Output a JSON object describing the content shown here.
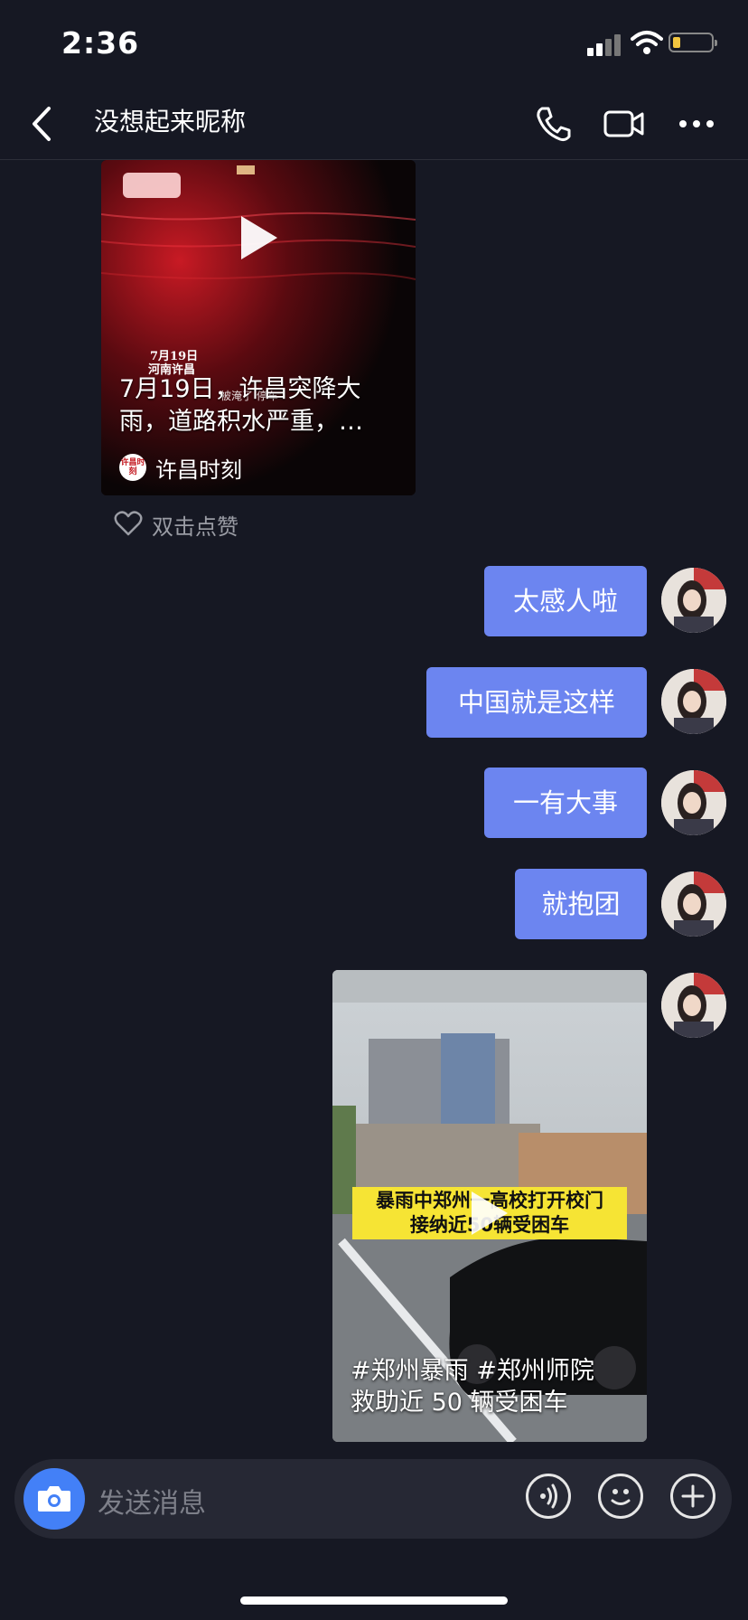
{
  "status_bar": {
    "time": "2:36"
  },
  "header": {
    "title": "没想起来昵称"
  },
  "messages": {
    "video1": {
      "overlay_date": "7月19日",
      "overlay_place": "河南许昌",
      "overlay_small": "被淹了 停车",
      "caption": "7月19日，许昌突降大雨，道路积水严重，…",
      "source_logo": "许昌时刻",
      "source": "许昌时刻",
      "like_hint": "双击点赞"
    },
    "bubbles": [
      "太感人啦",
      "中国就是这样",
      "一有大事",
      "就抱团"
    ],
    "video2": {
      "banner_line1": "暴雨中郑州一高校打开校门",
      "banner_line2": "接纳近50辆受困车",
      "caption": "#郑州暴雨 #郑州师院 救助近 50 辆受困车"
    }
  },
  "input": {
    "placeholder": "发送消息"
  },
  "colors": {
    "background": "#161823",
    "bubble": "#6c85f0",
    "camera_button": "#4380f7",
    "battery": "#f3c640"
  },
  "icons": [
    "back-icon",
    "phone-icon",
    "video-call-icon",
    "more-icon",
    "play-icon",
    "heart-icon",
    "camera-icon",
    "voice-icon",
    "emoji-icon",
    "plus-icon"
  ]
}
